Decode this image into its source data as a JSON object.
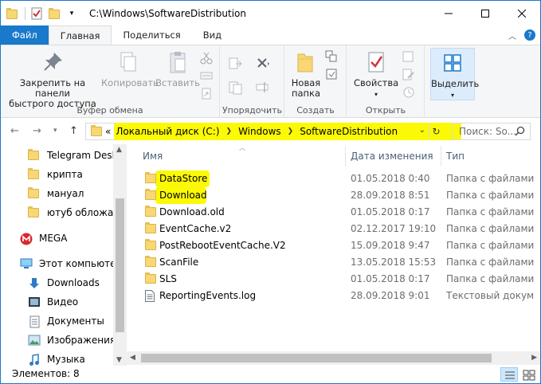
{
  "window": {
    "title": "C:\\Windows\\SoftwareDistribution",
    "controls": [
      "minimize",
      "maximize",
      "close"
    ]
  },
  "ribbon": {
    "tabs": [
      {
        "label": "Файл"
      },
      {
        "label": "Главная"
      },
      {
        "label": "Поделиться"
      },
      {
        "label": "Вид"
      }
    ],
    "groups": {
      "clipboard": {
        "label": "Буфер обмена",
        "pin": "Закрепить на панели быстрого доступа",
        "pin_line1": "Закрепить на панели",
        "pin_line2": "быстрого доступа",
        "copy": "Копировать",
        "paste": "Вставить"
      },
      "organize": {
        "label": "Упорядочить"
      },
      "new": {
        "label": "Создать",
        "new_folder_line1": "Новая",
        "new_folder_line2": "папка"
      },
      "open": {
        "label": "Открыть",
        "properties": "Свойства"
      },
      "select": {
        "label": "Выделить"
      }
    }
  },
  "address": {
    "prefix": "«",
    "crumbs": [
      "Локальный диск (C:)",
      "Windows",
      "SoftwareDistribution"
    ],
    "search_placeholder": "Поиск: So..."
  },
  "nav_pane": {
    "items": [
      {
        "label": "Telegram Deskto",
        "icon": "folder-icon"
      },
      {
        "label": "крипта",
        "icon": "folder-icon"
      },
      {
        "label": "мануал",
        "icon": "folder-icon"
      },
      {
        "label": "ютуб обложа",
        "icon": "folder-icon"
      },
      {
        "label": "MEGA",
        "icon": "mega-icon"
      },
      {
        "label": "Этот компьютер",
        "icon": "computer-icon"
      },
      {
        "label": "Downloads",
        "icon": "download-icon"
      },
      {
        "label": "Видео",
        "icon": "video-icon"
      },
      {
        "label": "Документы",
        "icon": "documents-icon"
      },
      {
        "label": "Изображения",
        "icon": "pictures-icon"
      },
      {
        "label": "Музыка",
        "icon": "music-icon"
      }
    ]
  },
  "file_list": {
    "columns": [
      "Имя",
      "Дата изменения",
      "Тип"
    ],
    "rows": [
      {
        "name": "DataStore",
        "date": "01.05.2018 0:40",
        "type": "Папка с файлами",
        "kind": "folder",
        "highlighted": true
      },
      {
        "name": "Download",
        "date": "28.09.2018 8:51",
        "type": "Папка с файлами",
        "kind": "folder",
        "highlighted": true
      },
      {
        "name": "Download.old",
        "date": "01.05.2018 0:17",
        "type": "Папка с файлами",
        "kind": "folder",
        "highlighted": false
      },
      {
        "name": "EventCache.v2",
        "date": "02.12.2017 19:10",
        "type": "Папка с файлами",
        "kind": "folder",
        "highlighted": false
      },
      {
        "name": "PostRebootEventCache.V2",
        "date": "15.09.2018 9:47",
        "type": "Папка с файлами",
        "kind": "folder",
        "highlighted": false
      },
      {
        "name": "ScanFile",
        "date": "13.05.2018 15:53",
        "type": "Папка с файлами",
        "kind": "folder",
        "highlighted": false
      },
      {
        "name": "SLS",
        "date": "01.05.2018 0:17",
        "type": "Папка с файлами",
        "kind": "folder",
        "highlighted": false
      },
      {
        "name": "ReportingEvents.log",
        "date": "28.09.2018 9:01",
        "type": "Текстовый докум",
        "kind": "file",
        "highlighted": false
      }
    ]
  },
  "status": {
    "items_count": "Элементов: 8"
  },
  "colors": {
    "accent": "#1979ca",
    "highlight": "#fcf906",
    "folder": "#f8d775"
  }
}
